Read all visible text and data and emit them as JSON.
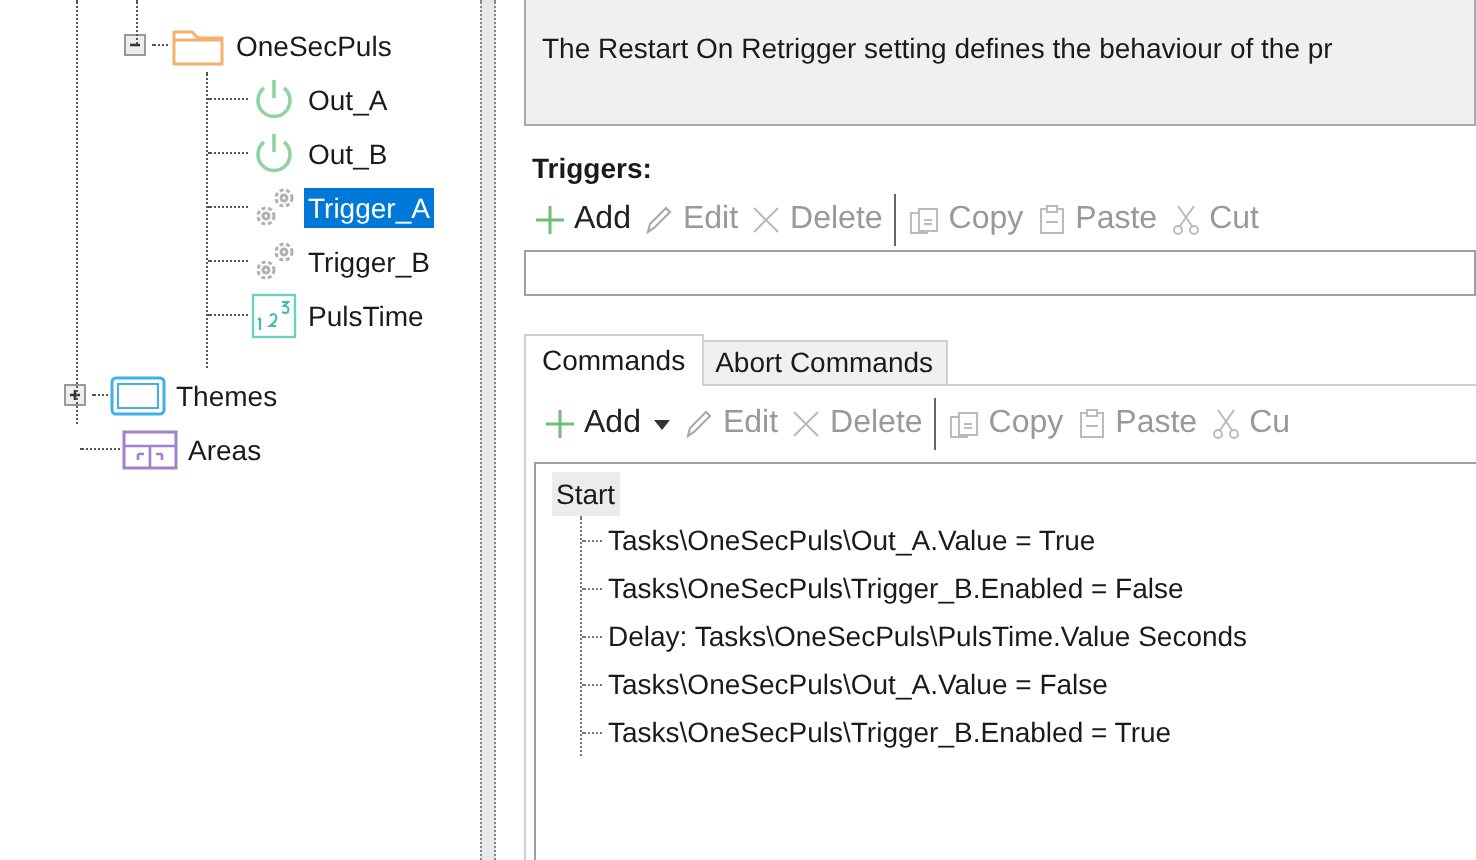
{
  "tree": [
    {
      "label": "OneSecPuls",
      "kind": "folder",
      "expanded": true,
      "selected": false,
      "children": [
        {
          "label": "Out_A",
          "kind": "output",
          "selected": false
        },
        {
          "label": "Out_B",
          "kind": "output",
          "selected": false
        },
        {
          "label": "Trigger_A",
          "kind": "trigger",
          "selected": true
        },
        {
          "label": "Trigger_B",
          "kind": "trigger",
          "selected": false
        },
        {
          "label": "PulsTime",
          "kind": "number",
          "selected": false
        }
      ]
    },
    {
      "label": "Themes",
      "kind": "themes",
      "expanded": false,
      "selected": false
    },
    {
      "label": "Areas",
      "kind": "areas",
      "selected": false
    }
  ],
  "description": "The Restart On Retrigger setting defines the behaviour of the pr",
  "triggers": {
    "label": "Triggers:",
    "toolbar": [
      {
        "label": "Add",
        "kind": "add",
        "disabled": false
      },
      {
        "label": "Edit",
        "kind": "edit",
        "disabled": true
      },
      {
        "label": "Delete",
        "kind": "delete",
        "disabled": true
      },
      {
        "label": "Copy",
        "kind": "copy",
        "disabled": true,
        "separator": true
      },
      {
        "label": "Paste",
        "kind": "paste",
        "disabled": true
      },
      {
        "label": "Cut",
        "kind": "cut",
        "disabled": true
      }
    ]
  },
  "tabs": [
    {
      "label": "Commands",
      "selected": true
    },
    {
      "label": "Abort Commands",
      "selected": false
    }
  ],
  "commands": {
    "toolbar": [
      {
        "label": "Add",
        "kind": "add",
        "disabled": false,
        "dropdown": true
      },
      {
        "label": "Edit",
        "kind": "edit",
        "disabled": true
      },
      {
        "label": "Delete",
        "kind": "delete",
        "disabled": true
      },
      {
        "label": "Copy",
        "kind": "copy",
        "disabled": true,
        "separator": true
      },
      {
        "label": "Paste",
        "kind": "paste",
        "disabled": true
      },
      {
        "label": "Cu",
        "kind": "cut",
        "disabled": true
      }
    ],
    "root": "Start",
    "items": [
      "Tasks\\OneSecPuls\\Out_A.Value = True",
      "Tasks\\OneSecPuls\\Trigger_B.Enabled = False",
      "Delay: Tasks\\OneSecPuls\\PulsTime.Value Seconds",
      "Tasks\\OneSecPuls\\Out_A.Value = False",
      "Tasks\\OneSecPuls\\Trigger_B.Enabled = True"
    ]
  }
}
